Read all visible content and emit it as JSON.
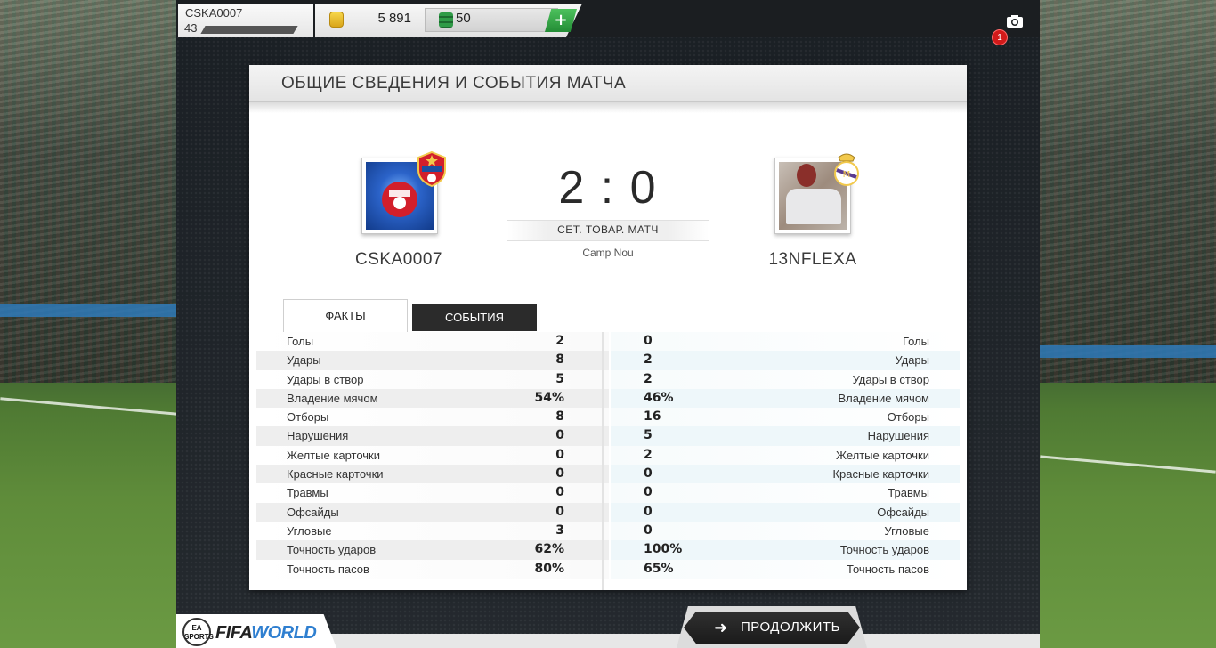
{
  "user": {
    "name": "CSKA0007",
    "level": "43",
    "coins": "5 891",
    "points": "50",
    "add_label": "+",
    "notifications": "1"
  },
  "card": {
    "title": "ОБЩИЕ СВЕДЕНИЯ И СОБЫТИЯ МАТЧА"
  },
  "match": {
    "home_team": "CSKA0007",
    "away_team": "13NFLEXA",
    "score": "2 : 0",
    "match_type": "СЕТ. ТОВАР. МАТЧ",
    "stadium": "Camp Nou"
  },
  "tabs": {
    "facts": "ФАКТЫ",
    "events": "СОБЫТИЯ"
  },
  "stats": [
    {
      "label": "Голы",
      "home": "2",
      "away": "0"
    },
    {
      "label": "Удары",
      "home": "8",
      "away": "2"
    },
    {
      "label": "Удары в створ",
      "home": "5",
      "away": "2"
    },
    {
      "label": "Владение мячом",
      "home": "54%",
      "away": "46%"
    },
    {
      "label": "Отборы",
      "home": "8",
      "away": "16"
    },
    {
      "label": "Нарушения",
      "home": "0",
      "away": "5"
    },
    {
      "label": "Желтые карточки",
      "home": "0",
      "away": "2"
    },
    {
      "label": "Красные карточки",
      "home": "0",
      "away": "0"
    },
    {
      "label": "Травмы",
      "home": "0",
      "away": "0"
    },
    {
      "label": "Офсайды",
      "home": "0",
      "away": "0"
    },
    {
      "label": "Угловые",
      "home": "3",
      "away": "0"
    },
    {
      "label": "Точность ударов",
      "home": "62%",
      "away": "100%"
    },
    {
      "label": "Точность пасов",
      "home": "80%",
      "away": "65%"
    }
  ],
  "footer": {
    "ea_badge": "EA SPORTS",
    "fifa_part": "FIFA",
    "world_part": "WORLD",
    "continue_label": "ПРОДОЛЖИТЬ"
  },
  "colors": {
    "accent_green": "#238c35",
    "badge_red": "#d11a1a",
    "dark_button": "#1b1b1b"
  }
}
